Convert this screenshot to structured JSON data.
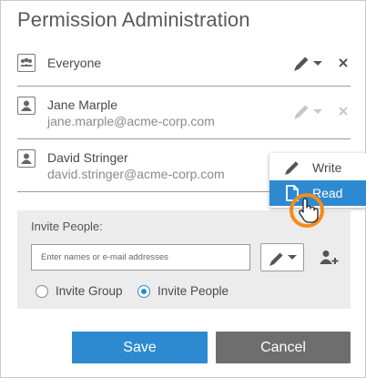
{
  "dialog": {
    "title": "Permission Administration"
  },
  "entries": [
    {
      "name": "Everyone",
      "email": "",
      "type": "group"
    },
    {
      "name": "Jane Marple",
      "email": "jane.marple@acme-corp.com",
      "type": "user"
    },
    {
      "name": "David Stringer",
      "email": "david.stringer@acme-corp.com",
      "type": "user"
    }
  ],
  "permission_menu": {
    "items": [
      {
        "label": "Write",
        "icon": "pencil-icon",
        "selected": false
      },
      {
        "label": "Read",
        "icon": "document-icon",
        "selected": true
      }
    ]
  },
  "invite": {
    "label": "Invite People:",
    "placeholder": "Enter names or e-mail addresses",
    "value": "",
    "options": [
      {
        "label": "Invite Group",
        "checked": false
      },
      {
        "label": "Invite People",
        "checked": true
      }
    ]
  },
  "buttons": {
    "save": "Save",
    "cancel": "Cancel"
  },
  "colors": {
    "accent": "#2e8ad0",
    "cancel": "#6e6e6e",
    "cursor_highlight": "#f28c1c",
    "panel": "#ececec"
  }
}
